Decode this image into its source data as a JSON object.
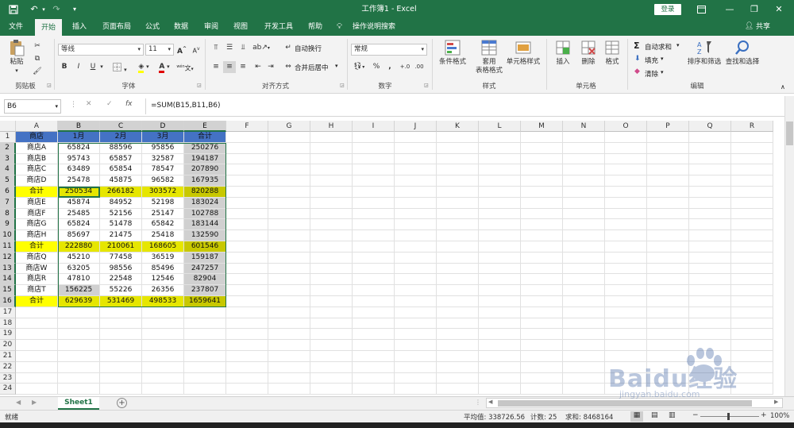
{
  "titlebar": {
    "save_icon": "save-icon",
    "undo_icon": "undo-icon",
    "redo_icon": "redo-icon",
    "title": "工作簿1 - Excel",
    "login": "登录",
    "window_buttons": [
      "ribbon-display-icon",
      "minimize-icon",
      "restore-icon",
      "close-icon"
    ]
  },
  "menu": {
    "tabs": [
      "文件",
      "开始",
      "插入",
      "页面布局",
      "公式",
      "数据",
      "审阅",
      "视图",
      "开发工具",
      "帮助"
    ],
    "active": "开始",
    "tell_me": "操作说明搜索",
    "share": "共享"
  },
  "ribbon": {
    "clipboard": {
      "paste": "粘贴",
      "label": "剪贴板"
    },
    "font": {
      "name": "等线",
      "size": "11",
      "bold": "B",
      "italic": "I",
      "underline": "U",
      "grow": "A",
      "shrink": "A",
      "wen": "wén",
      "label": "字体"
    },
    "alignment": {
      "wrap": "自动换行",
      "merge": "合并后居中",
      "label": "对齐方式"
    },
    "number": {
      "format": "常规",
      "label": "数字"
    },
    "styles": {
      "conditional": "条件格式",
      "table_line1": "套用",
      "table_line2": "表格格式",
      "cell_styles": "单元格样式",
      "label": "样式"
    },
    "cells": {
      "insert": "插入",
      "delete": "删除",
      "format": "格式",
      "label": "单元格"
    },
    "editing": {
      "autosum": "自动求和",
      "fill": "填充",
      "clear": "清除",
      "sort": "排序和筛选",
      "find": "查找和选择",
      "label": "编辑"
    }
  },
  "formula_bar": {
    "name_box": "B6",
    "cancel": "✕",
    "enter": "✓",
    "fx": "fx",
    "formula": "=SUM(B15,B11,B6)"
  },
  "columns": [
    "A",
    "B",
    "C",
    "D",
    "E",
    "F",
    "G",
    "H",
    "I",
    "J",
    "K",
    "L",
    "M",
    "N",
    "O",
    "P",
    "Q",
    "R"
  ],
  "rows": [
    "1",
    "2",
    "3",
    "4",
    "5",
    "6",
    "7",
    "8",
    "9",
    "10",
    "11",
    "12",
    "13",
    "14",
    "15",
    "16",
    "17",
    "18",
    "19",
    "20",
    "21",
    "22",
    "23",
    "24"
  ],
  "table": {
    "header": [
      "商店",
      "1月",
      "2月",
      "3月",
      "合计"
    ],
    "rows": [
      [
        "商店A",
        "65824",
        "88596",
        "95856",
        "250276"
      ],
      [
        "商店B",
        "95743",
        "65857",
        "32587",
        "194187"
      ],
      [
        "商店C",
        "63489",
        "65854",
        "78547",
        "207890"
      ],
      [
        "商店D",
        "25478",
        "45875",
        "96582",
        "167935"
      ],
      [
        "合计",
        "250534",
        "266182",
        "303572",
        "820288"
      ],
      [
        "商店E",
        "45874",
        "84952",
        "52198",
        "183024"
      ],
      [
        "商店F",
        "25485",
        "52156",
        "25147",
        "102788"
      ],
      [
        "商店G",
        "65824",
        "51478",
        "65842",
        "183144"
      ],
      [
        "商店H",
        "85697",
        "21475",
        "25418",
        "132590"
      ],
      [
        "合计",
        "222880",
        "210061",
        "168605",
        "601546"
      ],
      [
        "商店Q",
        "45210",
        "77458",
        "36519",
        "159187"
      ],
      [
        "商店W",
        "63205",
        "98556",
        "85496",
        "247257"
      ],
      [
        "商店R",
        "47810",
        "22548",
        "12546",
        "82904"
      ],
      [
        "商店T",
        "156225",
        "55226",
        "26356",
        "237807"
      ],
      [
        "合计",
        "629639",
        "531469",
        "498533",
        "1659641"
      ]
    ]
  },
  "sheets": {
    "active": "Sheet1",
    "add": "+"
  },
  "status": {
    "mode": "就绪",
    "average": "平均值: 338726.56",
    "count": "计数: 25",
    "sum": "求和: 8468164",
    "zoom": "100%"
  },
  "watermark": {
    "brand": "Baidu经验",
    "url": "jingyan.baidu.com"
  },
  "colors": {
    "excel_green": "#217346",
    "header_blue": "#4472c4",
    "sum_yellow": "#e6e600",
    "gray": "#d0d0d0"
  }
}
